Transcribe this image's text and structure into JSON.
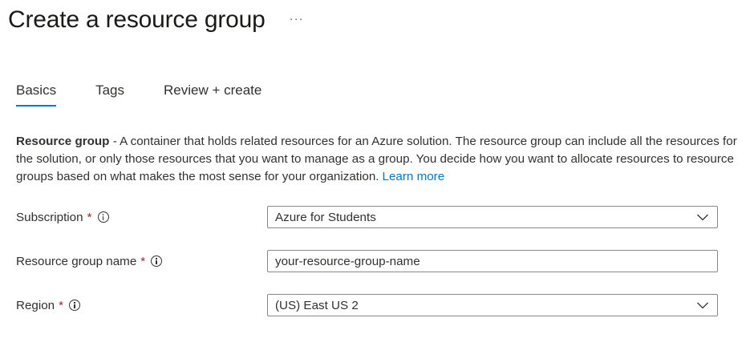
{
  "header": {
    "title": "Create a resource group",
    "more_label": "···"
  },
  "tabs": [
    {
      "label": "Basics",
      "active": true
    },
    {
      "label": "Tags",
      "active": false
    },
    {
      "label": "Review + create",
      "active": false
    }
  ],
  "description": {
    "term": "Resource group",
    "text": " - A container that holds related resources for an Azure solution. The resource group can include all the resources for the solution, or only those resources that you want to manage as a group. You decide how you want to allocate resources to resource groups based on what makes the most sense for your organization.",
    "link": "Learn more"
  },
  "form": {
    "subscription": {
      "label": "Subscription",
      "required_mark": "*",
      "value": "Azure for Students",
      "icon": "info-icon"
    },
    "resource_group_name": {
      "label": "Resource group name",
      "required_mark": "*",
      "value": "your-resource-group-name",
      "icon": "info-icon"
    },
    "region": {
      "label": "Region",
      "required_mark": "*",
      "value": "(US) East US 2",
      "icon": "info-icon"
    }
  },
  "colors": {
    "accent": "#0078d4",
    "required": "#a4262c",
    "text": "#323130",
    "border": "#8a8886"
  }
}
